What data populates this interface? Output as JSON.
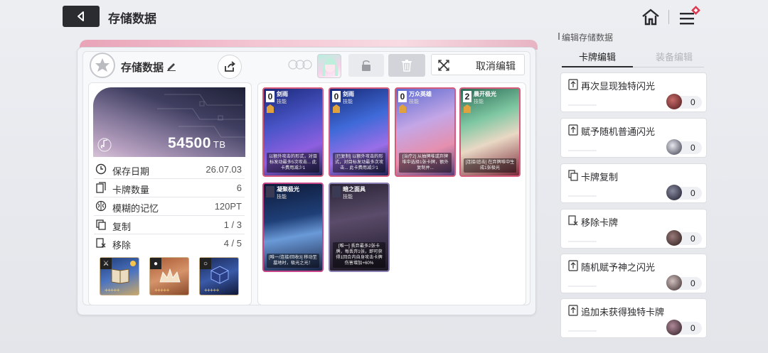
{
  "header": {
    "title": "存储数据"
  },
  "save": {
    "title": "存储数据",
    "cancel_label": "取消编辑",
    "tb_value": "54500",
    "tb_unit": "TB",
    "stats": [
      {
        "label": "保存日期",
        "value": "26.07.03",
        "icon": "clock-icon"
      },
      {
        "label": "卡牌数量",
        "value": "6",
        "icon": "card-count-icon"
      },
      {
        "label": "模糊的记忆",
        "value": "120PT",
        "icon": "brain-icon"
      },
      {
        "label": "复制",
        "value": "1 / 3",
        "icon": "copy-icon"
      },
      {
        "label": "移除",
        "value": "4 / 5",
        "icon": "remove-icon"
      }
    ],
    "relics": [
      {
        "name": "book-relic",
        "stars": "+++++",
        "color": "#3f5f9f"
      },
      {
        "name": "crown-relic",
        "stars": "+++++",
        "color": "#c07a4a"
      },
      {
        "name": "cube-relic",
        "stars": "+++++",
        "color": "#2b3f77"
      }
    ]
  },
  "cards": [
    {
      "cost": "0",
      "name": "剑雨",
      "type": "技能",
      "text": "以额外攻击的形式，对目标发动最多5次攻击... 此卡费用减少1",
      "bg": "linear-gradient(160deg,#1b2a7a,#4a55c8 40%,#8e5fe0 70%,#23265a)",
      "border": "#d65a7a"
    },
    {
      "cost": "0",
      "name": "剑雨",
      "type": "技能",
      "text": "[已复制] 以额外攻击的形式，对目标发动最多次攻击... 此卡费用减少1",
      "bg": "linear-gradient(160deg,#182a78,#3f6ad8 40%,#9a6ee8 70%,#1d2454)",
      "border": "#d65a7a"
    },
    {
      "cost": "0",
      "name": "万众英雄",
      "type": "技能",
      "text": "[治疗2] 从抽牌堆或弃牌堆中选择1张卡牌，额外复制并...",
      "bg": "linear-gradient(160deg,#5a6ad0,#c4a6e6 40%,#e58fae 70%,#5b3f7a)",
      "border": "#d65a7a"
    },
    {
      "cost": "2",
      "name": "晨开极光",
      "type": "技能",
      "text": "[连接/追击] 在弃牌堆中生成1张极光",
      "bg": "linear-gradient(160deg,#2c6a55,#7ec7a2 35%,#e9d8c4 60%,#7a2a3a)",
      "border": "#d65a7a"
    },
    {
      "cost": "",
      "name": "凝聚极光",
      "type": "技能",
      "text": "[唯一/连接/回收3] 移动至墓地时，极光之光！",
      "bg": "linear-gradient(170deg,#0e1a38,#1f3f78 40%,#6a9ad8 60%,#1a2446)",
      "border": "#c8478a"
    },
    {
      "cost": "",
      "name": "暗之面具",
      "type": "技能",
      "text": "[唯一] 丢弃最多2张卡牌，每丢弃1张，即可获得1回合内自身攻击卡牌伤害增加+60%",
      "bg": "linear-gradient(170deg,#2a2436,#5a4c6a 40%,#3a3048 70%,#1c1824)",
      "border": "#8a7fb0"
    }
  ],
  "sidebar": {
    "title": "编辑存储数据",
    "tabs": [
      {
        "label": "卡牌编辑",
        "active": true
      },
      {
        "label": "装备编辑",
        "active": false
      }
    ],
    "items": [
      {
        "label": "再次显现独特闪光",
        "count": "0",
        "coin": "#6a2a2a"
      },
      {
        "label": "赋予随机普通闪光",
        "count": "0",
        "coin": "#5a5a6a"
      },
      {
        "label": "卡牌复制",
        "count": "0",
        "coin": "#3a3a4a"
      },
      {
        "label": "移除卡牌",
        "count": "0",
        "coin": "#4a3a3a"
      },
      {
        "label": "随机赋予神之闪光",
        "count": "0",
        "coin": "#5a4a4a"
      },
      {
        "label": "追加未获得独特卡牌",
        "count": "0",
        "coin": "#4a3a44"
      }
    ]
  }
}
